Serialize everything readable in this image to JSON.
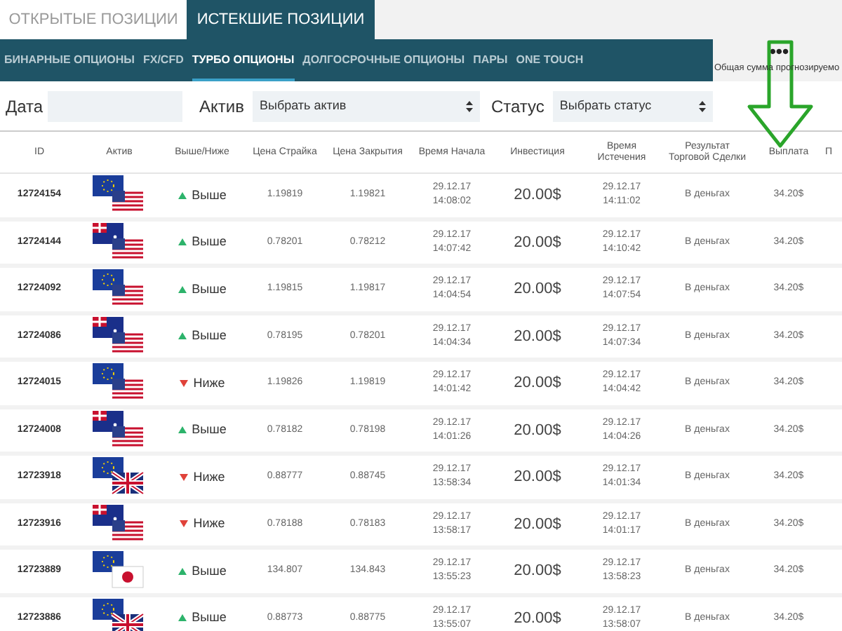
{
  "top_tabs": [
    {
      "label": "ОТКРЫТЫЕ ПОЗИЦИИ",
      "selected": false
    },
    {
      "label": "ИСТЕКШИЕ ПОЗИЦИИ",
      "selected": true
    }
  ],
  "sub_tabs": [
    {
      "label": "БИНАРНЫЕ ОПЦИОНЫ",
      "selected": false
    },
    {
      "label": "FX/CFD",
      "selected": false
    },
    {
      "label": "ТУРБО ОПЦИОНЫ",
      "selected": true
    },
    {
      "label": "ДОЛГОСРОЧНЫЕ ОПЦИОНЫ",
      "selected": false
    },
    {
      "label": "ПАРЫ",
      "selected": false
    },
    {
      "label": "ONE TOUCH",
      "selected": false
    }
  ],
  "summary": {
    "more": "•••",
    "label": "Общая сумма прогнозируемо"
  },
  "filters": {
    "date_label": "Дата",
    "asset_label": "Актив",
    "asset_value": "Выбрать актив",
    "status_label": "Статус",
    "status_value": "Выбрать статус"
  },
  "table": {
    "columns": [
      "ID",
      "Актив",
      "Выше/Ниже",
      "Цена Страйка",
      "Цена Закрытия",
      "Время Начала",
      "Инвестиция",
      "Время Истечения",
      "Результат Торговой Сделки",
      "Выплата",
      "П"
    ],
    "rows": [
      {
        "id": "12724154",
        "flags": {
          "kind": "eur_usd"
        },
        "direction": {
          "kind": "up",
          "label": "Выше"
        },
        "strike": "1.19819",
        "close": "1.19821",
        "start": [
          "29.12.17",
          "14:08:02"
        ],
        "investment": "20.00$",
        "expiry": [
          "29.12.17",
          "14:11:02"
        ],
        "result": "В деньгах",
        "payout": "34.20$"
      },
      {
        "id": "12724144",
        "flags": {
          "kind": "aud_usd"
        },
        "direction": {
          "kind": "up",
          "label": "Выше"
        },
        "strike": "0.78201",
        "close": "0.78212",
        "start": [
          "29.12.17",
          "14:07:42"
        ],
        "investment": "20.00$",
        "expiry": [
          "29.12.17",
          "14:10:42"
        ],
        "result": "В деньгах",
        "payout": "34.20$"
      },
      {
        "id": "12724092",
        "flags": {
          "kind": "eur_usd"
        },
        "direction": {
          "kind": "up",
          "label": "Выше"
        },
        "strike": "1.19815",
        "close": "1.19817",
        "start": [
          "29.12.17",
          "14:04:54"
        ],
        "investment": "20.00$",
        "expiry": [
          "29.12.17",
          "14:07:54"
        ],
        "result": "В деньгах",
        "payout": "34.20$"
      },
      {
        "id": "12724086",
        "flags": {
          "kind": "aud_usd"
        },
        "direction": {
          "kind": "up",
          "label": "Выше"
        },
        "strike": "0.78195",
        "close": "0.78201",
        "start": [
          "29.12.17",
          "14:04:34"
        ],
        "investment": "20.00$",
        "expiry": [
          "29.12.17",
          "14:07:34"
        ],
        "result": "В деньгах",
        "payout": "34.20$"
      },
      {
        "id": "12724015",
        "flags": {
          "kind": "eur_usd"
        },
        "direction": {
          "kind": "down",
          "label": "Ниже"
        },
        "strike": "1.19826",
        "close": "1.19819",
        "start": [
          "29.12.17",
          "14:01:42"
        ],
        "investment": "20.00$",
        "expiry": [
          "29.12.17",
          "14:04:42"
        ],
        "result": "В деньгах",
        "payout": "34.20$"
      },
      {
        "id": "12724008",
        "flags": {
          "kind": "aud_usd"
        },
        "direction": {
          "kind": "up",
          "label": "Выше"
        },
        "strike": "0.78182",
        "close": "0.78198",
        "start": [
          "29.12.17",
          "14:01:26"
        ],
        "investment": "20.00$",
        "expiry": [
          "29.12.17",
          "14:04:26"
        ],
        "result": "В деньгах",
        "payout": "34.20$"
      },
      {
        "id": "12723918",
        "flags": {
          "kind": "eur_gbp"
        },
        "direction": {
          "kind": "down",
          "label": "Ниже"
        },
        "strike": "0.88777",
        "close": "0.88745",
        "start": [
          "29.12.17",
          "13:58:34"
        ],
        "investment": "20.00$",
        "expiry": [
          "29.12.17",
          "14:01:34"
        ],
        "result": "В деньгах",
        "payout": "34.20$"
      },
      {
        "id": "12723916",
        "flags": {
          "kind": "aud_usd"
        },
        "direction": {
          "kind": "down",
          "label": "Ниже"
        },
        "strike": "0.78188",
        "close": "0.78183",
        "start": [
          "29.12.17",
          "13:58:17"
        ],
        "investment": "20.00$",
        "expiry": [
          "29.12.17",
          "14:01:17"
        ],
        "result": "В деньгах",
        "payout": "34.20$"
      },
      {
        "id": "12723889",
        "flags": {
          "kind": "eur_jpy"
        },
        "direction": {
          "kind": "up",
          "label": "Выше"
        },
        "strike": "134.807",
        "close": "134.843",
        "start": [
          "29.12.17",
          "13:55:23"
        ],
        "investment": "20.00$",
        "expiry": [
          "29.12.17",
          "13:58:23"
        ],
        "result": "В деньгах",
        "payout": "34.20$"
      },
      {
        "id": "12723886",
        "flags": {
          "kind": "eur_gbp"
        },
        "direction": {
          "kind": "up",
          "label": "Выше"
        },
        "strike": "0.88773",
        "close": "0.88775",
        "start": [
          "29.12.17",
          "13:55:07"
        ],
        "investment": "20.00$",
        "expiry": [
          "29.12.17",
          "13:58:07"
        ],
        "result": "В деньгах",
        "payout": "34.20$"
      }
    ]
  }
}
